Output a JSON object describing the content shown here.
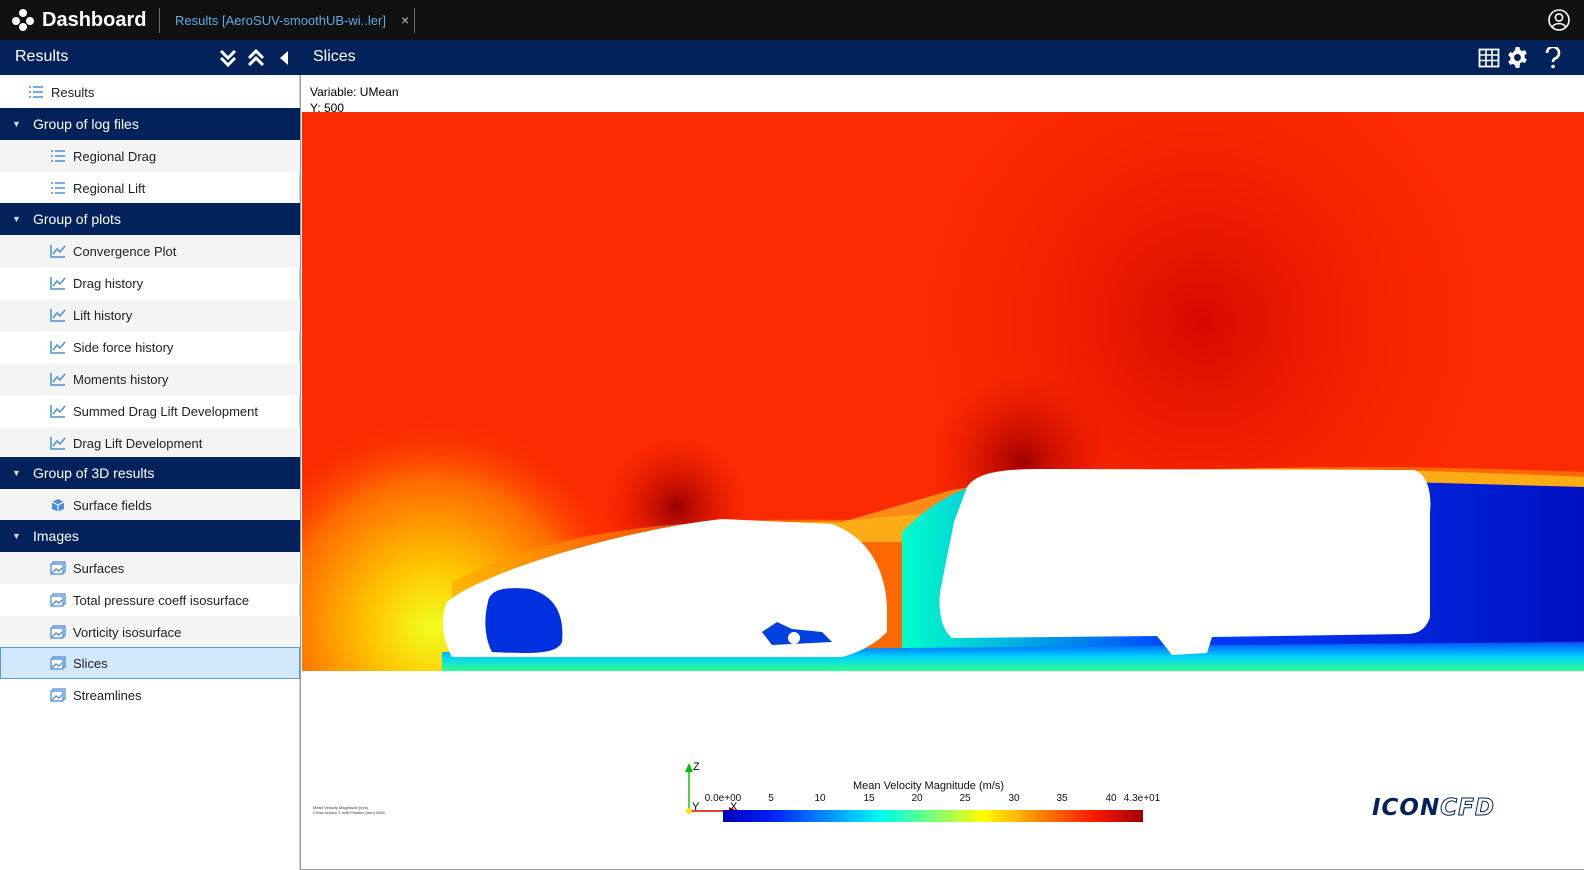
{
  "app": {
    "title": "Dashboard",
    "tab_label": "Results [AeroSUV-smoothUB-wi..ler]",
    "tab_close": "×"
  },
  "left_panel": {
    "title": "Results",
    "icons": [
      "double-chevron-down-icon",
      "double-chevron-up-icon",
      "triangle-left-icon"
    ]
  },
  "main_panel": {
    "title": "Slices",
    "icons": [
      "grid-icon",
      "gear-icon",
      "help-icon"
    ]
  },
  "tree": {
    "root": "Results",
    "groups": [
      {
        "label": "Group of log files",
        "items": [
          "Regional Drag",
          "Regional Lift"
        ]
      },
      {
        "label": "Group of plots",
        "items": [
          "Convergence Plot",
          "Drag history",
          "Lift history",
          "Side force history",
          "Moments history",
          "Summed Drag Lift Development",
          "Drag Lift Development"
        ]
      },
      {
        "label": "Group of 3D results",
        "items": [
          "Surface fields"
        ]
      },
      {
        "label": "Images",
        "items": [
          "Surfaces",
          "Total pressure coeff isosurface",
          "Vorticity isosurface",
          "Slices",
          "Streamlines"
        ]
      }
    ],
    "selected": "Slices"
  },
  "viewer": {
    "variable_line": "Variable: UMean",
    "y_line": "Y: 500",
    "axes": {
      "z": "Z",
      "y": "Y",
      "x": "X"
    },
    "colorbar": {
      "title": "Mean Velocity Magnitude (m/s)",
      "ticks": [
        "0.0e+00",
        "5",
        "10",
        "15",
        "20",
        "25",
        "30",
        "35",
        "40",
        "4.3e+01"
      ]
    },
    "small_note_1": "Mean Velocity Magnitude (m/s)",
    "small_note_2": "Cross section Y with Position (mm) 0000",
    "logo_text_1": "ICON",
    "logo_text_2": "CFD"
  },
  "colors": {
    "header": "#03215a",
    "topbar": "#111111",
    "accent": "#5fa8e6"
  }
}
